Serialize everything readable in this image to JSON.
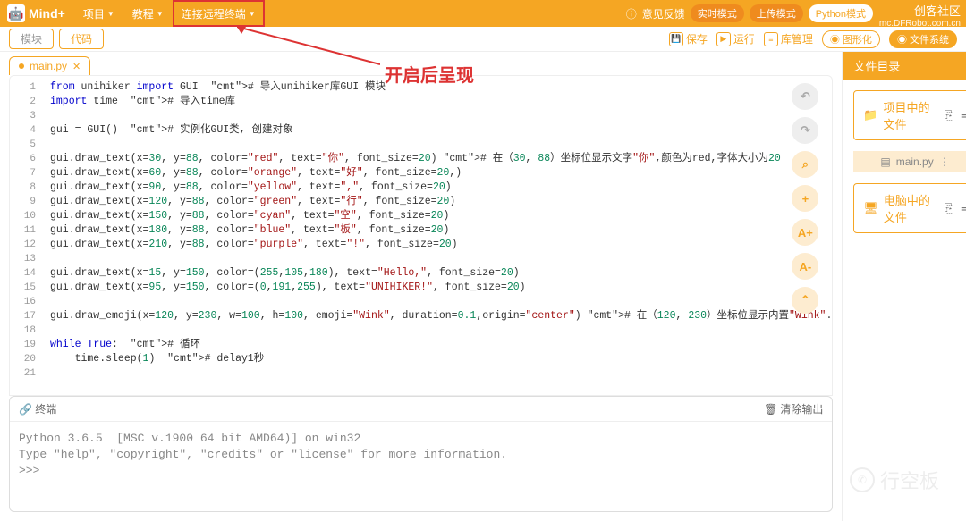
{
  "topbar": {
    "logo": "Mind+",
    "menus": [
      "项目",
      "教程",
      "连接远程终端"
    ],
    "feedback": "意见反馈",
    "realtime_mode": "实时模式",
    "upload_mode": "上传模式",
    "python_mode": "Python模式",
    "corner_title": "创客社区",
    "corner_sub": "mc.DFRobot.com.cn"
  },
  "toolbar": {
    "blocks": "模块",
    "code_tab": "代码",
    "save": "保存",
    "run": "运行",
    "lib": "库管理",
    "graph": "图形化",
    "filesys": "文件系统"
  },
  "file_tab": {
    "name": "main.py"
  },
  "annotation": "开启后呈现",
  "code_lines": [
    "from unihiker import GUI  # 导入unihiker库GUI 模块",
    "import time  # 导入time库",
    "",
    "gui = GUI()  # 实例化GUI类, 创建对象",
    "",
    "gui.draw_text(x=30, y=88, color=\"red\", text=\"你\", font_size=20) # 在（30, 88）坐标位显示文字\"你\",颜色为red,字体大小为20",
    "gui.draw_text(x=60, y=88, color=\"orange\", text=\"好\", font_size=20,)",
    "gui.draw_text(x=90, y=88, color=\"yellow\", text=\",\", font_size=20)",
    "gui.draw_text(x=120, y=88, color=\"green\", text=\"行\", font_size=20)",
    "gui.draw_text(x=150, y=88, color=\"cyan\", text=\"空\", font_size=20)",
    "gui.draw_text(x=180, y=88, color=\"blue\", text=\"板\", font_size=20)",
    "gui.draw_text(x=210, y=88, color=\"purple\", text=\"!\", font_size=20)",
    "",
    "gui.draw_text(x=15, y=150, color=(255,105,180), text=\"Hello,\", font_size=20)",
    "gui.draw_text(x=95, y=150, color=(0,191,255), text=\"UNIHIKER!\", font_size=20)",
    "",
    "gui.draw_emoji(x=120, y=230, w=100, h=100, emoji=\"Wink\", duration=0.1,origin=\"center\") # 在（120, 230）坐标位显示内置\"Wink\".",
    "",
    "while True:  # 循环",
    "    time.sleep(1)  # delay1秒",
    ""
  ],
  "side_buttons": [
    "↶",
    "↷",
    "⌕",
    "+",
    "A+",
    "A-",
    "⌃"
  ],
  "terminal": {
    "title": "终端",
    "clear": "清除输出",
    "line1": "Python 3.6.5  [MSC v.1900 64 bit AMD64)] on win32",
    "line2": "Type \"help\", \"copyright\", \"credits\" or \"license\" for more information.",
    "prompt": ">>> _"
  },
  "sidebar": {
    "header": "文件目录",
    "project_files": "项目中的文件",
    "file": "main.py",
    "computer_files": "电脑中的文件"
  },
  "watermark": "行空板"
}
